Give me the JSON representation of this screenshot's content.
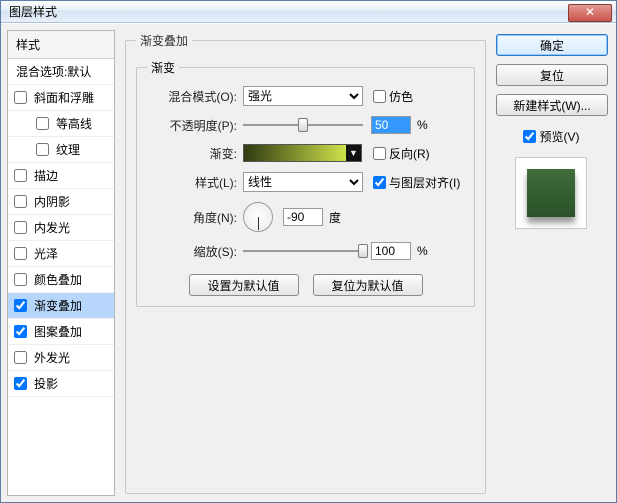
{
  "window": {
    "title": "图层样式"
  },
  "sidebar": {
    "header": "样式",
    "blend_options": "混合选项:默认",
    "items": [
      {
        "label": "斜面和浮雕",
        "checked": false,
        "indent": false
      },
      {
        "label": "等高线",
        "checked": false,
        "indent": true
      },
      {
        "label": "纹理",
        "checked": false,
        "indent": true
      },
      {
        "label": "描边",
        "checked": false,
        "indent": false
      },
      {
        "label": "内阴影",
        "checked": false,
        "indent": false
      },
      {
        "label": "内发光",
        "checked": false,
        "indent": false
      },
      {
        "label": "光泽",
        "checked": false,
        "indent": false
      },
      {
        "label": "颜色叠加",
        "checked": false,
        "indent": false
      },
      {
        "label": "渐变叠加",
        "checked": true,
        "indent": false,
        "selected": true
      },
      {
        "label": "图案叠加",
        "checked": true,
        "indent": false
      },
      {
        "label": "外发光",
        "checked": false,
        "indent": false
      },
      {
        "label": "投影",
        "checked": true,
        "indent": false
      }
    ]
  },
  "main": {
    "group_title": "渐变叠加",
    "inner_title": "渐变",
    "blend_mode_label": "混合模式(O):",
    "blend_mode_value": "强光",
    "dither_label": "仿色",
    "opacity_label": "不透明度(P):",
    "opacity_value": "50",
    "opacity_pct": 50,
    "pct_sign": "%",
    "gradient_label": "渐变:",
    "reverse_label": "反向(R)",
    "style_label": "样式(L):",
    "style_value": "线性",
    "align_label": "与图层对齐(I)",
    "angle_label": "角度(N):",
    "angle_value": "-90",
    "angle_unit": "度",
    "scale_label": "缩放(S):",
    "scale_value": "100",
    "scale_pct": 100,
    "reset_default": "设置为默认值",
    "restore_default": "复位为默认值"
  },
  "right": {
    "ok": "确定",
    "reset": "复位",
    "new_style": "新建样式(W)...",
    "preview_label": "预览(V)"
  }
}
